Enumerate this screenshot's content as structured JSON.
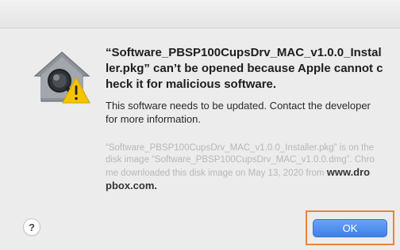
{
  "dialog": {
    "headline": "“Software_PBSP100CupsDrv_MAC_v1.0.0_Installer.pkg” can’t be opened because Apple cannot check it for malicious software.",
    "message": "This software needs to be updated. Contact the developer for more information.",
    "detail": {
      "text": "“Software_PBSP100CupsDrv_MAC_v1.0.0_Installer.pkg” is on the disk image “Software_PBSP100CupsDrv_MAC_v1.0.0.dmg”. Chrome downloaded this disk image on May 13, 2020 from",
      "source_link": "www.dropbox.com",
      "suffix": "."
    },
    "help_label": "?",
    "ok_label": "OK"
  },
  "icons": {
    "app_icon": "gatekeeper-warning-icon"
  },
  "colors": {
    "ok_button": "#4a89f0",
    "highlight_box": "#e8843a",
    "warning_triangle": "#f5c400"
  }
}
